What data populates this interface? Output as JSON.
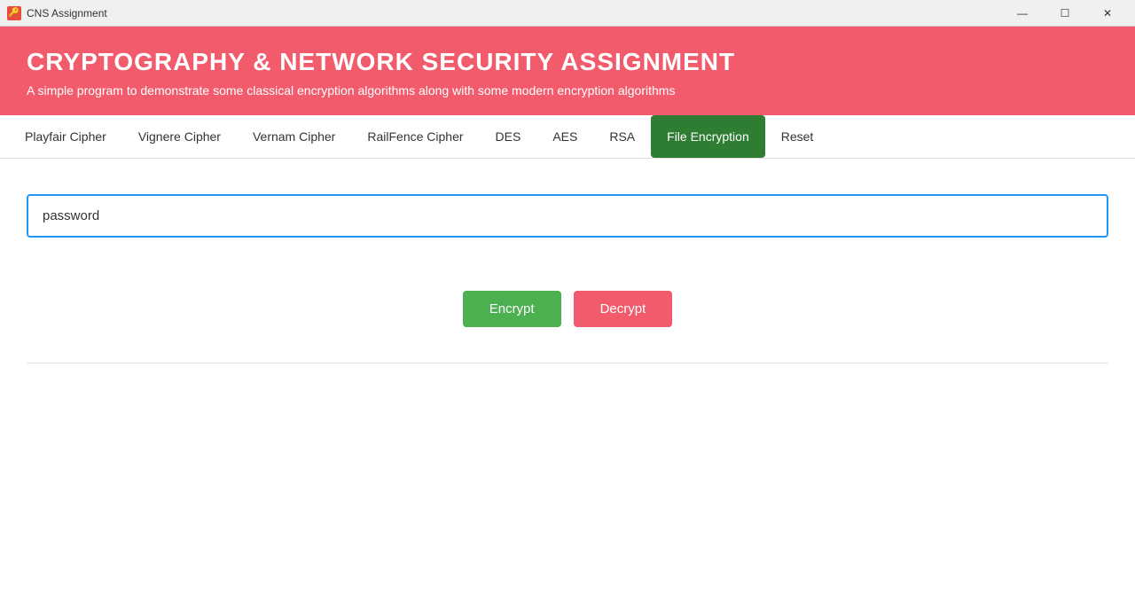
{
  "titlebar": {
    "icon": "🔑",
    "title": "CNS Assignment",
    "minimize": "—",
    "maximize": "☐",
    "close": "✕"
  },
  "header": {
    "title": "CRYPTOGRAPHY & NETWORK SECURITY ASSIGNMENT",
    "subtitle": "A simple program to demonstrate some classical encryption algorithms along with some modern encryption algorithms"
  },
  "nav": {
    "items": [
      {
        "label": "Playfair Cipher",
        "active": false
      },
      {
        "label": "Vignere Cipher",
        "active": false
      },
      {
        "label": "Vernam Cipher",
        "active": false
      },
      {
        "label": "RailFence Cipher",
        "active": false
      },
      {
        "label": "DES",
        "active": false
      },
      {
        "label": "AES",
        "active": false
      },
      {
        "label": "RSA",
        "active": false
      },
      {
        "label": "File Encryption",
        "active": true
      },
      {
        "label": "Reset",
        "active": false
      }
    ]
  },
  "content": {
    "password_placeholder": "password",
    "encrypt_label": "Encrypt",
    "decrypt_label": "Decrypt"
  }
}
